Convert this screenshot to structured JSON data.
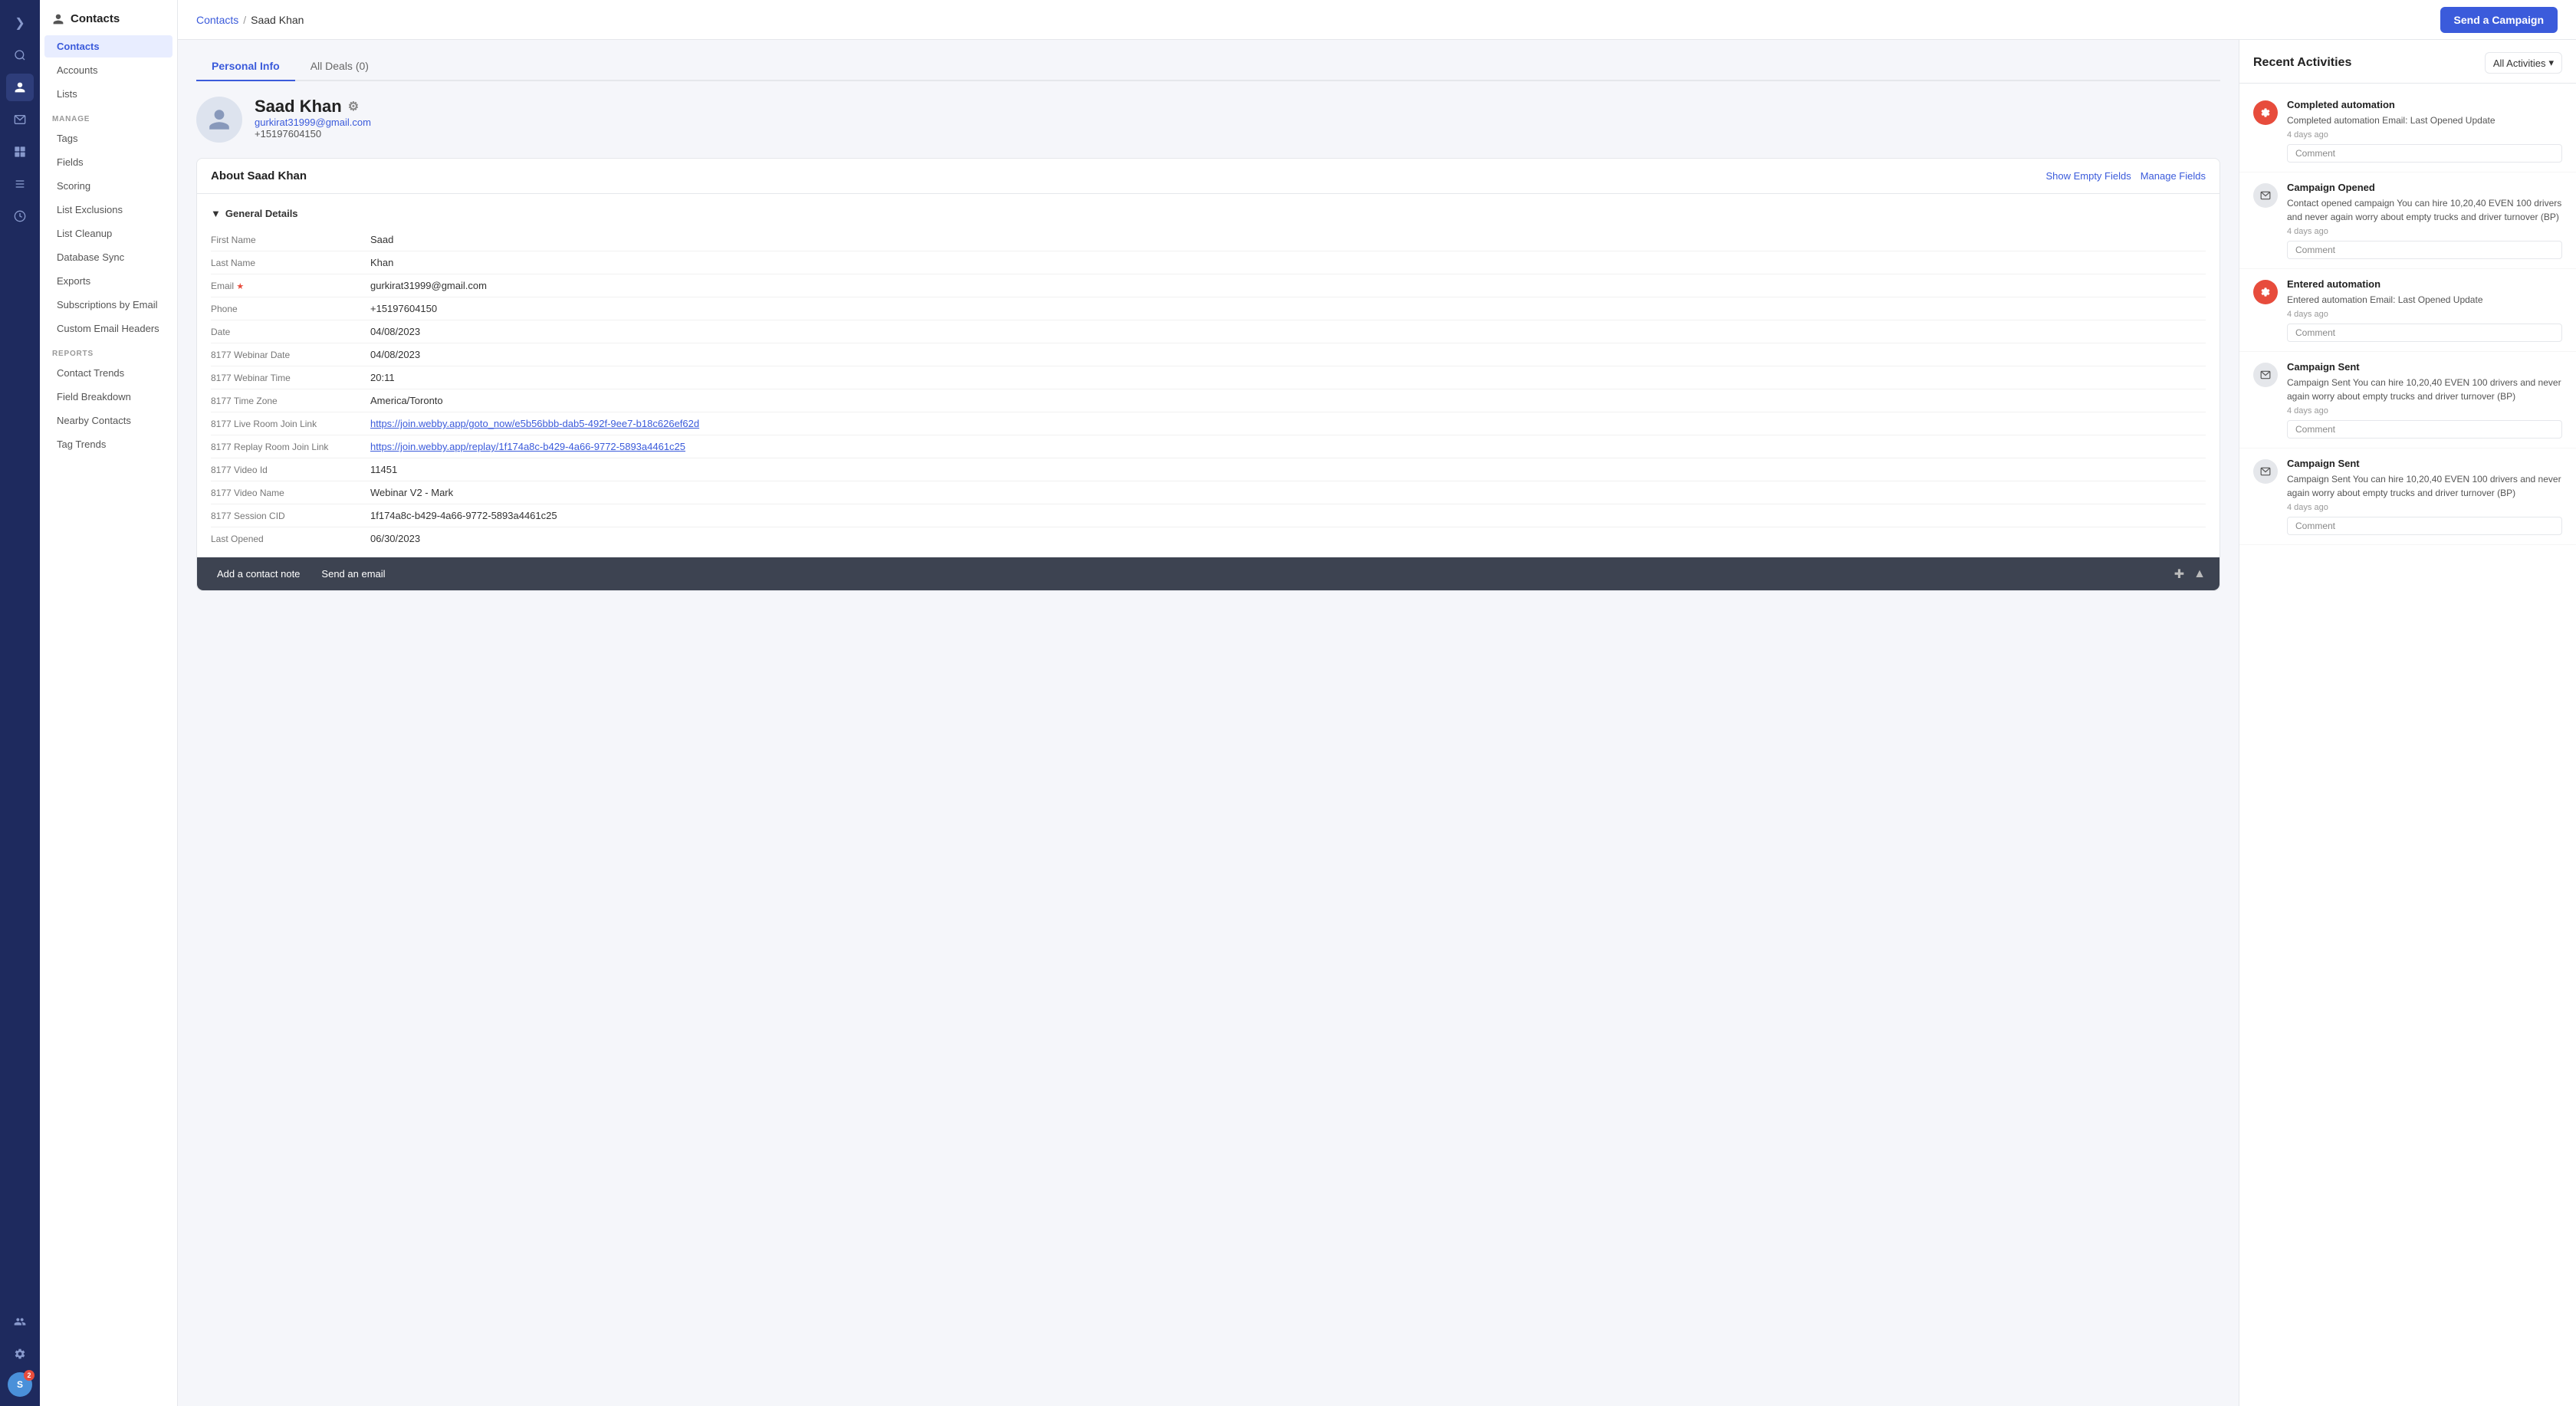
{
  "app": {
    "title": "Contacts"
  },
  "iconRail": {
    "icons": [
      {
        "name": "chevron-right-icon",
        "symbol": "❯",
        "active": false
      },
      {
        "name": "search-icon",
        "symbol": "🔍",
        "active": false
      },
      {
        "name": "person-icon",
        "symbol": "👤",
        "active": true
      },
      {
        "name": "email-icon",
        "symbol": "✉",
        "active": false
      },
      {
        "name": "chart-bar-icon",
        "symbol": "▬",
        "active": false
      },
      {
        "name": "list-icon",
        "symbol": "≡",
        "active": false
      },
      {
        "name": "clock-icon",
        "symbol": "◔",
        "active": false
      }
    ],
    "bottomIcons": [
      {
        "name": "users-icon",
        "symbol": "👥"
      },
      {
        "name": "gear-icon",
        "symbol": "⚙"
      }
    ],
    "avatar": {
      "initials": "S",
      "badge": "2"
    }
  },
  "sidebar": {
    "title": "Contacts",
    "navItems": [
      {
        "label": "Contacts",
        "active": true
      },
      {
        "label": "Accounts",
        "active": false
      },
      {
        "label": "Lists",
        "active": false
      }
    ],
    "manageSectionLabel": "MANAGE",
    "manageItems": [
      {
        "label": "Tags"
      },
      {
        "label": "Fields"
      },
      {
        "label": "Scoring"
      },
      {
        "label": "List Exclusions"
      },
      {
        "label": "List Cleanup"
      },
      {
        "label": "Database Sync"
      },
      {
        "label": "Exports"
      },
      {
        "label": "Subscriptions by Email"
      },
      {
        "label": "Custom Email Headers"
      }
    ],
    "reportsSectionLabel": "REPORTS",
    "reportItems": [
      {
        "label": "Contact Trends"
      },
      {
        "label": "Field Breakdown"
      },
      {
        "label": "Nearby Contacts"
      },
      {
        "label": "Tag Trends"
      }
    ]
  },
  "topBar": {
    "breadcrumb": {
      "parent": "Contacts",
      "separator": "/",
      "current": "Saad Khan"
    },
    "sendCampaignBtn": "Send a Campaign"
  },
  "tabs": [
    {
      "label": "Personal Info",
      "active": true
    },
    {
      "label": "All Deals (0)",
      "active": false
    }
  ],
  "contactHeader": {
    "name": "Saad Khan",
    "email": "gurkirat31999@gmail.com",
    "phone": "+15197604150"
  },
  "aboutSection": {
    "title": "About Saad Khan",
    "actions": [
      "Show Empty Fields",
      "Manage Fields"
    ],
    "detailsGroup": "General Details",
    "fields": [
      {
        "label": "First Name",
        "value": "Saad",
        "type": "text"
      },
      {
        "label": "Last Name",
        "value": "Khan",
        "type": "text"
      },
      {
        "label": "Email",
        "value": "gurkirat31999@gmail.com",
        "type": "email",
        "required": true
      },
      {
        "label": "Phone",
        "value": "+15197604150",
        "type": "text"
      },
      {
        "label": "Date",
        "value": "04/08/2023",
        "type": "text"
      },
      {
        "label": "8177 Webinar Date",
        "value": "04/08/2023",
        "type": "text"
      },
      {
        "label": "8177 Webinar Time",
        "value": "20:11",
        "type": "text"
      },
      {
        "label": "8177 Time Zone",
        "value": "America/Toronto",
        "type": "text"
      },
      {
        "label": "8177 Live Room Join Link",
        "value": "https://join.webby.app/goto_now/e5b56bbb-dab5-492f-9ee7-b18c626ef62d",
        "type": "link"
      },
      {
        "label": "8177 Replay Room Join Link",
        "value": "https://join.webby.app/replay/1f174a8c-b429-4a66-9772-5893a4461c25",
        "type": "link"
      },
      {
        "label": "8177 Video Id",
        "value": "11451",
        "type": "text"
      },
      {
        "label": "8177 Video Name",
        "value": "Webinar V2 - Mark",
        "type": "text"
      },
      {
        "label": "8177 Session CID",
        "value": "1f174a8c-b429-4a66-9772-5893a4461c25",
        "type": "text"
      },
      {
        "label": "Last Opened",
        "value": "06/30/2023",
        "type": "text"
      }
    ]
  },
  "bottomBar": {
    "addNote": "Add a contact note",
    "sendEmail": "Send an email"
  },
  "activities": {
    "title": "Recent Activities",
    "filterLabel": "All Activities",
    "items": [
      {
        "type": "automation",
        "iconSymbol": "⚙",
        "title": "Completed automation",
        "description": "Completed automation Email: Last Opened Update",
        "boldPart": "Email: Last Opened Update",
        "time": "4 days ago",
        "commentLabel": "Comment"
      },
      {
        "type": "email",
        "iconSymbol": "✉",
        "title": "Campaign Opened",
        "description": "Contact opened campaign You can hire 10,20,40 EVEN 100 drivers and never again worry about empty trucks and driver turnover (BP)",
        "boldPart": "You can hire 10,20,40 EVEN 100 drivers and never again worry about empty trucks and driver turnover (BP)",
        "time": "4 days ago",
        "commentLabel": "Comment"
      },
      {
        "type": "automation",
        "iconSymbol": "⚙",
        "title": "Entered automation",
        "description": "Entered automation Email: Last Opened Update",
        "boldPart": "Email: Last Opened Update",
        "time": "4 days ago",
        "commentLabel": "Comment"
      },
      {
        "type": "email",
        "iconSymbol": "✉",
        "title": "Campaign Sent",
        "description": "Campaign Sent You can hire 10,20,40 EVEN 100 drivers and never again worry about empty trucks and driver turnover (BP)",
        "boldPart": "You can hire 10,20,40 EVEN 100 drivers and never again worry about empty trucks and driver turnover (BP)",
        "time": "4 days ago",
        "commentLabel": "Comment"
      },
      {
        "type": "email",
        "iconSymbol": "✉",
        "title": "Campaign Sent",
        "description": "Campaign Sent You can hire 10,20,40 EVEN 100 drivers and never again worry about empty trucks and driver turnover (BP)",
        "boldPart": "You can hire 10,20,40 EVEN 100 drivers and never again worry about empty trucks and driver turnover (BP)",
        "time": "4 days ago",
        "commentLabel": "Comment"
      }
    ]
  }
}
